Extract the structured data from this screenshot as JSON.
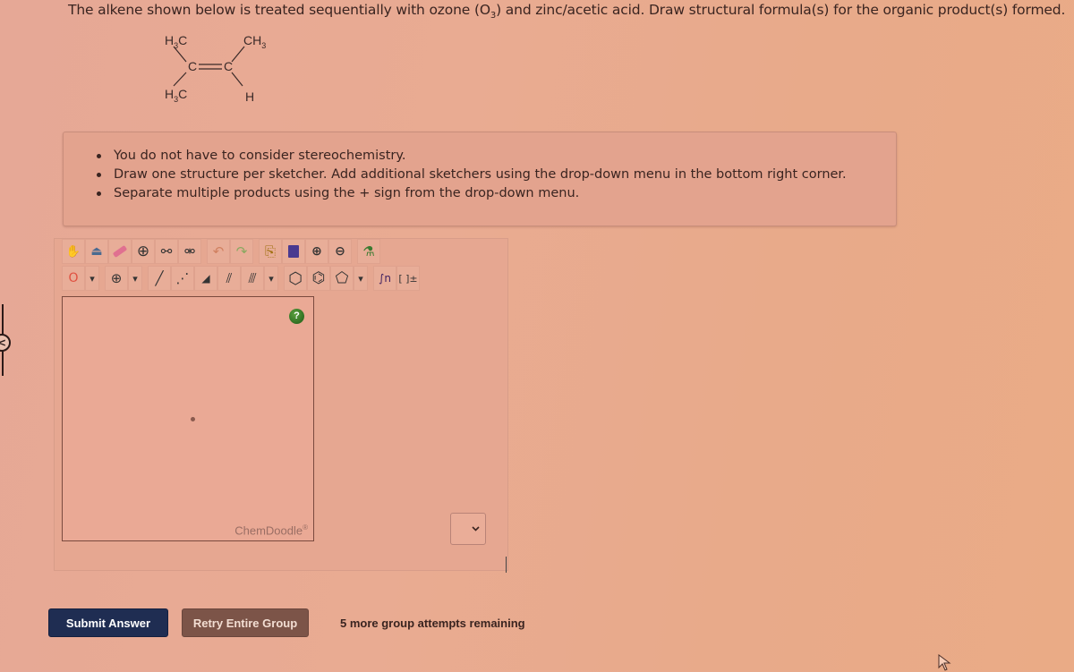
{
  "question": {
    "text_before": "The alkene shown below is treated sequentially with ozone (O",
    "subscript": "3",
    "text_after": ") and zinc/acetic acid. Draw structural formula(s) for the organic product(s) formed."
  },
  "molecule": {
    "name": "2-methyl-2-butene",
    "left_top": "H3C",
    "left_bottom": "H3C",
    "right_top": "CH3",
    "right_bottom": "H",
    "left_carbon": "C",
    "right_carbon": "C",
    "bond": "="
  },
  "instructions": [
    "You do not have to consider stereochemistry.",
    "Draw one structure per sketcher. Add additional sketchers using the drop-down menu in the bottom right corner.",
    "Separate multiple products using the + sign from the drop-down menu."
  ],
  "sketcher": {
    "toolbar_row1": [
      {
        "name": "hand-tool",
        "glyph": "✋"
      },
      {
        "name": "clear-tool",
        "glyph": "🧴"
      },
      {
        "name": "eraser-tool",
        "glyph": "▬"
      },
      {
        "name": "center-tool",
        "glyph": "⊕"
      },
      {
        "name": "flip-horizontal-tool",
        "glyph": "⚯"
      },
      {
        "name": "flip-vertical-tool",
        "glyph": "⚮"
      },
      {
        "name": "undo-tool",
        "glyph": "↶"
      },
      {
        "name": "redo-tool",
        "glyph": "↷"
      },
      {
        "name": "copy-tool",
        "glyph": "⎘"
      },
      {
        "name": "paste-tool",
        "glyph": "📋"
      },
      {
        "name": "zoom-in-tool",
        "glyph": "🔍"
      },
      {
        "name": "zoom-out-tool",
        "glyph": "🔎"
      },
      {
        "name": "clean-tool",
        "glyph": "⚗"
      }
    ],
    "toolbar_row2": [
      {
        "name": "atom-oxygen-tool",
        "glyph": "O"
      },
      {
        "name": "atom-dropdown",
        "glyph": "▾"
      },
      {
        "name": "charge-plus-tool",
        "glyph": "⊕"
      },
      {
        "name": "charge-dropdown",
        "glyph": "▾"
      },
      {
        "name": "single-bond-tool",
        "glyph": "╱"
      },
      {
        "name": "hashed-bond-tool",
        "glyph": "⋰"
      },
      {
        "name": "wedge-bond-tool",
        "glyph": "◢"
      },
      {
        "name": "double-bond-tool",
        "glyph": "⫽"
      },
      {
        "name": "triple-bond-tool",
        "glyph": "⫻"
      },
      {
        "name": "bond-dropdown",
        "glyph": "▾"
      },
      {
        "name": "cyclohexane-tool",
        "glyph": "⬡"
      },
      {
        "name": "benzene-tool",
        "glyph": "⌬"
      },
      {
        "name": "cyclopentane-tool",
        "glyph": "⬠"
      },
      {
        "name": "ring-dropdown",
        "glyph": "▾"
      },
      {
        "name": "repeat-unit-tool",
        "glyph": "∫n"
      },
      {
        "name": "bracket-charge-tool",
        "glyph": "[ ]±"
      }
    ],
    "help_label": "?",
    "brand": "ChemDoodle",
    "brand_mark": "®"
  },
  "buttons": {
    "submit": "Submit Answer",
    "retry": "Retry Entire Group"
  },
  "attempts_text": "5 more group attempts remaining",
  "colors": {
    "submit_bg": "#1f2d52",
    "retry_bg": "#7c5448",
    "help_green": "#2f7a22"
  }
}
